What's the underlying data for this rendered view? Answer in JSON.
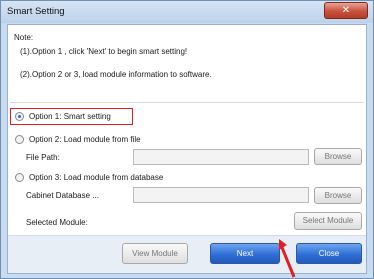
{
  "window": {
    "title": "Smart Setting",
    "close_glyph": "✕"
  },
  "note": {
    "heading": "Note:",
    "line1": "(1).Option 1 , click 'Next' to begin smart setting!",
    "line2": "(2).Option 2 or 3, load module information to software."
  },
  "options": {
    "opt1": {
      "label": "Option 1: Smart setting",
      "selected": true
    },
    "opt2": {
      "label": "Option 2: Load module from file",
      "selected": false
    },
    "opt3": {
      "label": "Option 3: Load module from database",
      "selected": false
    }
  },
  "file_path": {
    "label": "File Path:",
    "value": "",
    "browse_label": "Browse"
  },
  "cabinet_db": {
    "label": "Cabinet Database ...",
    "value": "",
    "browse_label": "Browse"
  },
  "selected_module": {
    "label": "Selected Module:",
    "button_label": "Select Module"
  },
  "footer": {
    "view_module_label": "View Module",
    "next_label": "Next",
    "close_label": "Close"
  },
  "colors": {
    "highlight_box": "#e02020",
    "primary_button": "#2f6fd8",
    "arrow": "#e02020"
  }
}
